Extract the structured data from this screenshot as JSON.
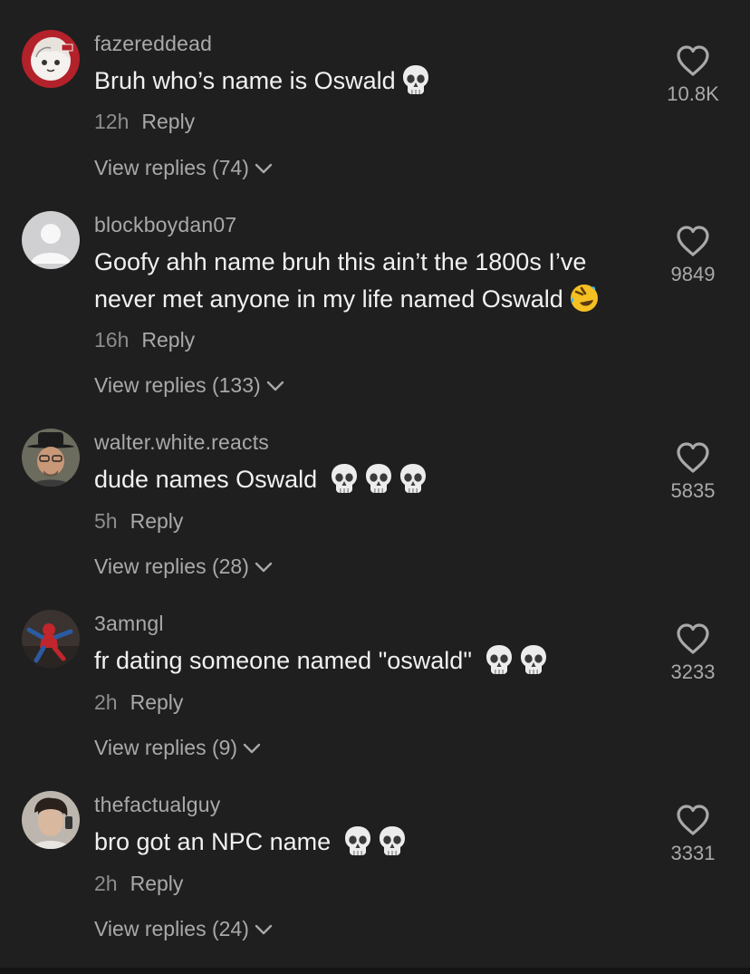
{
  "comments": [
    {
      "username": "fazereddead",
      "text": "Bruh who’s name is Oswald",
      "time": "12h",
      "reply_label": "Reply",
      "view_replies": "View replies (74)",
      "likes": "10.8K",
      "emoji": "skull-emoji",
      "avatar": "anime-avatar"
    },
    {
      "username": "blockboydan07",
      "text": "Goofy ahh name bruh this ain’t the 1800s I’ve never met anyone in my life named Oswald",
      "time": "16h",
      "reply_label": "Reply",
      "view_replies": "View replies (133)",
      "likes": "9849",
      "emoji": "rolling-on-floor-laughing-emoji",
      "avatar": "default-avatar"
    },
    {
      "username": "walter.white.reacts",
      "text": "dude names Oswald",
      "time": "5h",
      "reply_label": "Reply",
      "view_replies": "View replies (28)",
      "likes": "5835",
      "emoji": "skull-emoji",
      "avatar": "walter-white-avatar"
    },
    {
      "username": "3amngl",
      "text": "fr dating someone named \"oswald\"",
      "time": "2h",
      "reply_label": "Reply",
      "view_replies": "View replies (9)",
      "likes": "3233",
      "emoji": "skull-emoji",
      "avatar": "spiderman-avatar"
    },
    {
      "username": "thefactualguy",
      "text": "bro got an NPC name",
      "time": "2h",
      "reply_label": "Reply",
      "view_replies": "View replies (24)",
      "likes": "3331",
      "emoji": "skull-emoji",
      "avatar": "profile-photo-avatar"
    }
  ],
  "colors": {
    "background": "#1f1f1f",
    "username": "#a9a9ab",
    "text": "#f1f1f1",
    "meta": "#8c8c8e"
  }
}
